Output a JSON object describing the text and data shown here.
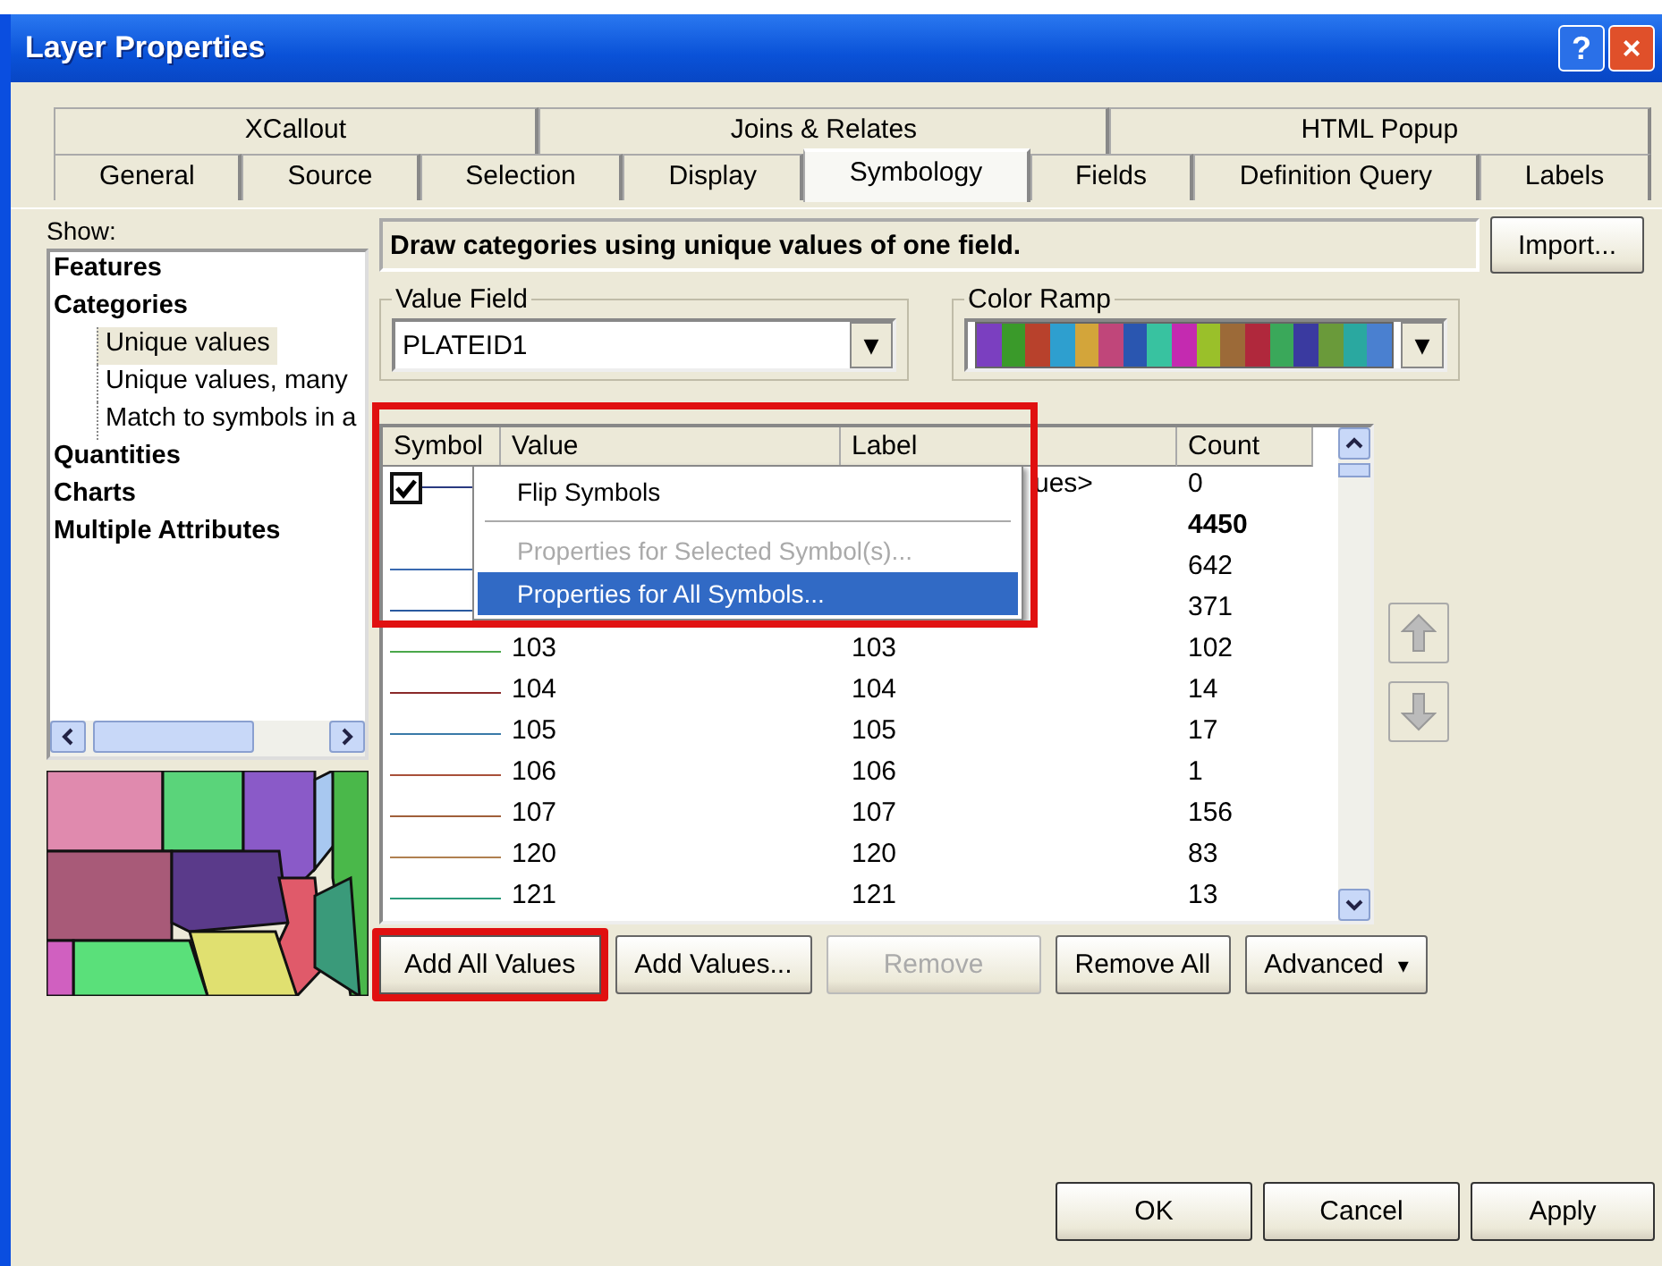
{
  "window": {
    "title": "Layer Properties",
    "help": "?",
    "close": "×"
  },
  "tabs": [
    [
      {
        "label": "XCallout",
        "selected": false
      },
      {
        "label": "Joins & Relates",
        "selected": false
      },
      {
        "label": "HTML Popup",
        "selected": false
      }
    ],
    [
      {
        "label": "General",
        "selected": false
      },
      {
        "label": "Source",
        "selected": false
      },
      {
        "label": "Selection",
        "selected": false
      },
      {
        "label": "Display",
        "selected": false
      },
      {
        "label": "Symbology",
        "selected": true
      },
      {
        "label": "Fields",
        "selected": false
      },
      {
        "label": "Definition Query",
        "selected": false
      },
      {
        "label": "Labels",
        "selected": false
      }
    ]
  ],
  "show": {
    "label": "Show:",
    "items": [
      {
        "label": "Features",
        "selected": false
      },
      {
        "label": "Categories",
        "selected": false,
        "children": [
          {
            "label": "Unique values",
            "selected": true
          },
          {
            "label": "Unique values, many",
            "selected": false
          },
          {
            "label": "Match to symbols in a",
            "selected": false
          }
        ]
      },
      {
        "label": "Quantities",
        "selected": false
      },
      {
        "label": "Charts",
        "selected": false
      },
      {
        "label": "Multiple Attributes",
        "selected": false
      }
    ]
  },
  "description": "Draw categories using unique values of one field.",
  "import_button": "Import...",
  "value_field": {
    "label": "Value Field",
    "value": "PLATEID1",
    "arrow": "▼"
  },
  "color_ramp": {
    "label": "Color Ramp",
    "arrow": "▼",
    "swatches": [
      {
        "color": "#7b3fc0"
      },
      {
        "color": "#3a9a2a"
      },
      {
        "color": "#b8412c"
      },
      {
        "color": "#2e9fcf"
      },
      {
        "color": "#d3a53a"
      },
      {
        "color": "#c0467a"
      },
      {
        "color": "#2a56b0"
      },
      {
        "color": "#38c2a0"
      },
      {
        "color": "#c42ab0"
      },
      {
        "color": "#9ac02a"
      },
      {
        "color": "#9c6a38"
      },
      {
        "color": "#b0283c"
      },
      {
        "color": "#3aa85a"
      },
      {
        "color": "#3a3aa0"
      },
      {
        "color": "#6a9a3a"
      },
      {
        "color": "#2aa8a0"
      },
      {
        "color": "#4a80d0"
      }
    ]
  },
  "table": {
    "columns": [
      "Symbol",
      "Value",
      "Label",
      "Count"
    ],
    "rows": [
      {
        "checked": true,
        "color": "#2a3a80",
        "label": "ues>",
        "count": "0",
        "kind": "item"
      },
      {
        "count": "4450",
        "kind": "heading"
      },
      {
        "color": "#3a6ab0",
        "count": "642",
        "kind": "item"
      },
      {
        "color": "#2a5aa0",
        "count": "371",
        "kind": "item"
      },
      {
        "color": "#4aa84a",
        "value": "103",
        "label": "103",
        "count": "102",
        "kind": "item"
      },
      {
        "color": "#8a2a2a",
        "value": "104",
        "label": "104",
        "count": "14",
        "kind": "item"
      },
      {
        "color": "#3a7aa8",
        "value": "105",
        "label": "105",
        "count": "17",
        "kind": "item"
      },
      {
        "color": "#a8503a",
        "value": "106",
        "label": "106",
        "count": "1",
        "kind": "item"
      },
      {
        "color": "#a0603a",
        "value": "107",
        "label": "107",
        "count": "156",
        "kind": "item"
      },
      {
        "color": "#b08050",
        "value": "120",
        "label": "120",
        "count": "83",
        "kind": "item"
      },
      {
        "color": "#2a9a7a",
        "value": "121",
        "label": "121",
        "count": "13",
        "kind": "item"
      }
    ]
  },
  "context_menu": [
    {
      "kind": "item",
      "label": "Flip Symbols",
      "disabled": false,
      "selected": false
    },
    {
      "kind": "separator"
    },
    {
      "kind": "item",
      "label": "Properties for Selected Symbol(s)...",
      "disabled": true,
      "selected": false
    },
    {
      "kind": "item",
      "label": "Properties for All Symbols...",
      "disabled": false,
      "selected": true
    }
  ],
  "actions": [
    {
      "label": "Add All Values",
      "disabled": false,
      "highlighted": true,
      "kind": "plain"
    },
    {
      "label": "Add Values...",
      "disabled": false,
      "highlighted": false,
      "kind": "plain"
    },
    {
      "label": "Remove",
      "disabled": true,
      "highlighted": false,
      "kind": "plain"
    },
    {
      "label": "Remove All",
      "disabled": false,
      "highlighted": false,
      "kind": "plain"
    },
    {
      "label": "Advanced",
      "disabled": false,
      "highlighted": false,
      "kind": "dropdown",
      "caret": "▾"
    }
  ],
  "footer": [
    "OK",
    "Cancel",
    "Apply"
  ]
}
